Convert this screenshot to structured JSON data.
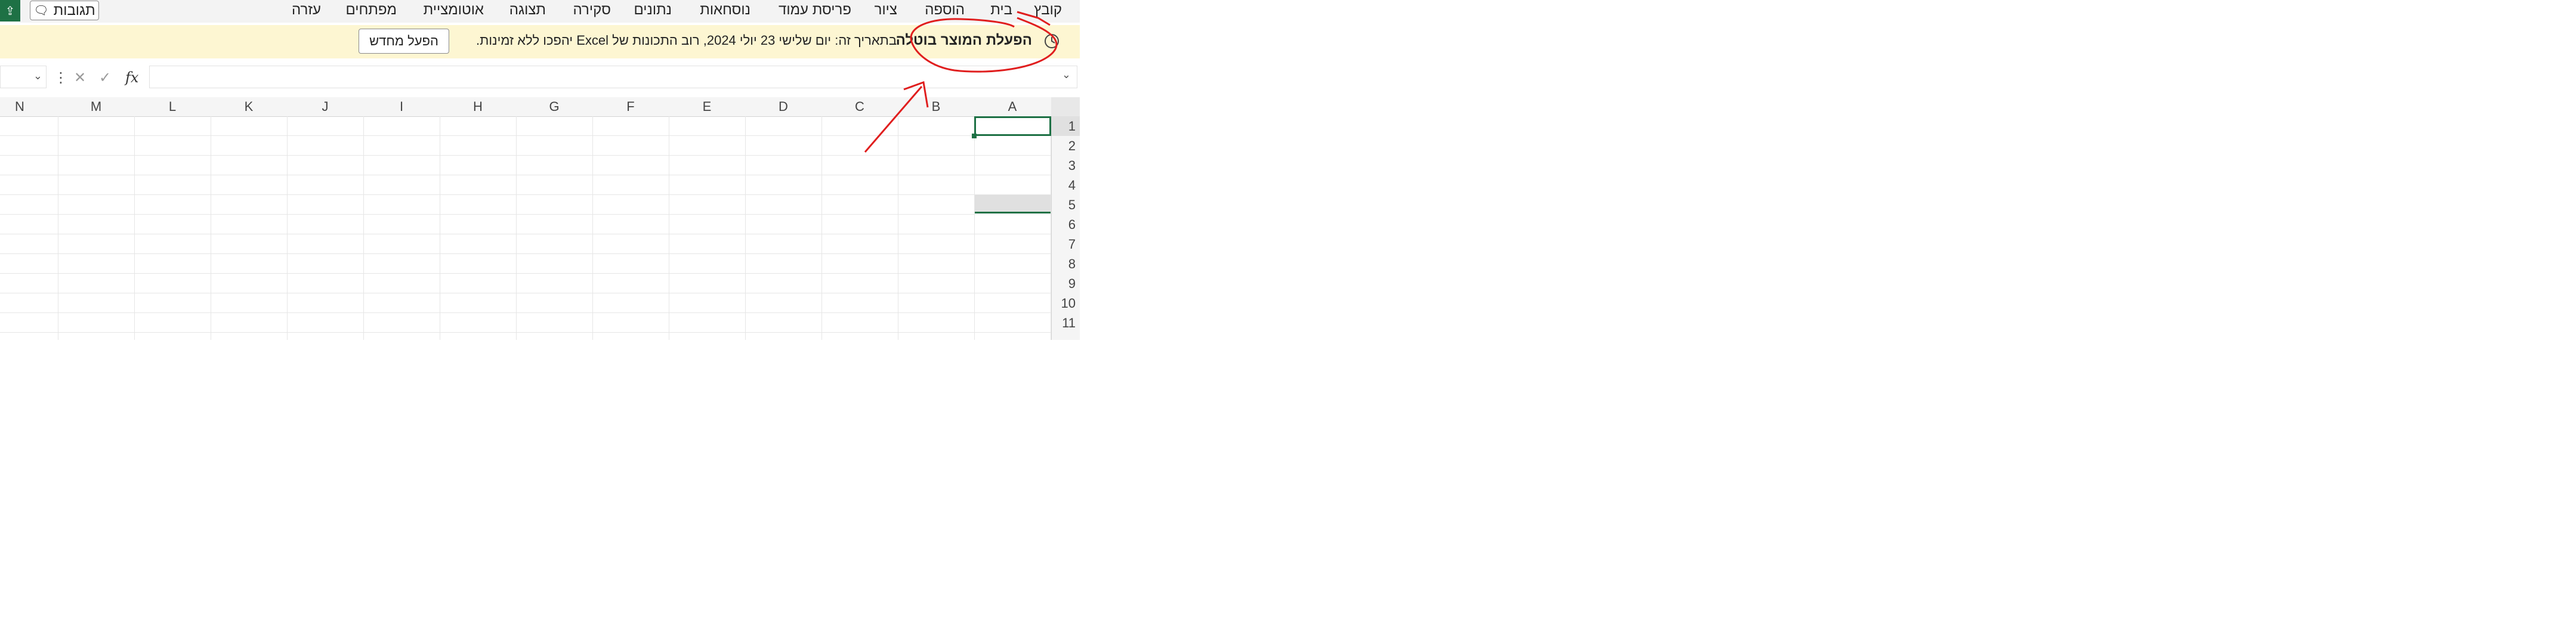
{
  "menubar": {
    "items": [
      "קובץ",
      "בית",
      "הוספה",
      "ציור",
      "פריסת עמוד",
      "נוסחאות",
      "נתונים",
      "סקירה",
      "תצוגה",
      "אוטומציית",
      "מפתחים",
      "עזרה"
    ],
    "comments_label": "תגובות",
    "comments_icon": "comment-icon",
    "share_icon": "share-icon"
  },
  "banner": {
    "title": "הפעלת המוצר בוטלה",
    "message": "בתאריך זה: יום שלישי 23 יולי 2024, רוב התכונות של Excel יהפכו ללא זמינות.",
    "button_label": "הפעל מחדש",
    "icon": "warning-clock-icon"
  },
  "formula_bar": {
    "value": "",
    "name_box": "",
    "fx_label": "fx"
  },
  "grid": {
    "columns": [
      "A",
      "B",
      "C",
      "D",
      "E",
      "F",
      "G",
      "H",
      "I",
      "J",
      "K",
      "L",
      "M",
      "N"
    ],
    "rows": [
      "1",
      "2",
      "3",
      "4",
      "5",
      "6",
      "7",
      "8",
      "9",
      "10",
      "11"
    ],
    "selected_cell": "A1"
  },
  "colors": {
    "accent": "#1e7145",
    "banner_bg": "#fdf6d2",
    "annotation": "#e01e1e"
  }
}
